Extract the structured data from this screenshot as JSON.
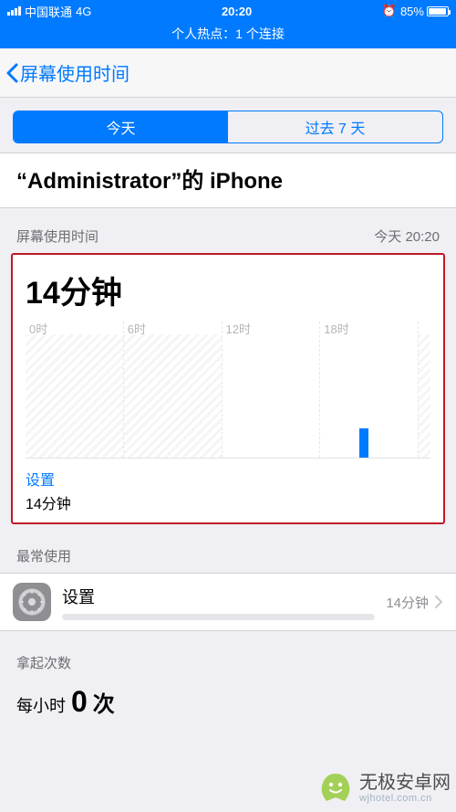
{
  "status": {
    "carrier": "中国联通",
    "network": "4G",
    "time": "20:20",
    "battery_pct": "85%"
  },
  "hotspot": "个人热点：1 个连接",
  "nav": {
    "back": "屏幕使用时间"
  },
  "segmented": {
    "today": "今天",
    "past7": "过去 7 天"
  },
  "device_title": "“Administrator”的 iPhone",
  "usage_header": {
    "left": "屏幕使用时间",
    "right": "今天 20:20"
  },
  "chart_data": {
    "type": "bar",
    "total_label": "14分钟",
    "hour_labels": [
      "0时",
      "6时",
      "12时",
      "18时"
    ],
    "bars": [
      {
        "hour": 20,
        "minutes": 14
      }
    ],
    "y_max_minutes": 60,
    "top_app": {
      "name": "设置",
      "duration": "14分钟"
    }
  },
  "most_used": {
    "header": "最常使用",
    "items": [
      {
        "name": "设置",
        "duration": "14分钟"
      }
    ]
  },
  "pickups": {
    "header": "拿起次数",
    "per_hour_label": "每小时",
    "count": "0",
    "unit": "次"
  },
  "watermark": {
    "title": "无极安卓网",
    "sub": "wjhotel.com.cn"
  }
}
